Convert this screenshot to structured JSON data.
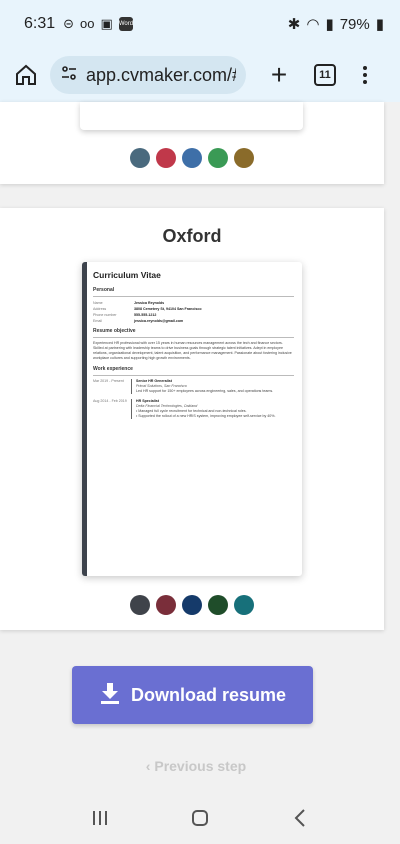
{
  "status_bar": {
    "time": "6:31",
    "left_icons": [
      "minus-circle-icon",
      "voicemail-icon",
      "image-icon",
      "app-badge-icon"
    ],
    "app_badge_text": "Word",
    "right_icons": [
      "bluetooth-icon",
      "wifi-icon",
      "signal-icon"
    ],
    "battery": "79%"
  },
  "browser": {
    "url": "app.cvmaker.com/#",
    "tab_count": "11"
  },
  "top_card": {
    "colors": [
      "#4a6a7e",
      "#c0384a",
      "#3e6fa8",
      "#3a9a55",
      "#8a6b2a"
    ]
  },
  "oxford": {
    "title": "Oxford",
    "colors": [
      "#3f434a",
      "#7a2e3a",
      "#153a6a",
      "#1f4d2a",
      "#17707a"
    ],
    "cv": {
      "heading": "Curriculum Vitae",
      "personal_label": "Personal",
      "fields": [
        {
          "key": "Name",
          "value": "Jessica Reynolds"
        },
        {
          "key": "Address",
          "value": "3808 Cemetery St, 94104 San Francisco"
        },
        {
          "key": "Phone number",
          "value": "555-555-1212"
        },
        {
          "key": "Email",
          "value": "jessica.reynolds@gmail.com"
        }
      ],
      "objective_label": "Resume objective",
      "objective": "Experienced HR professional with over 15 years in human resources management across the tech and finance sectors. Skilled at partnering with leadership teams to drive business goals through strategic talent initiatives. Adept in employee relations, organizational development, talent acquisition, and performance management. Passionate about fostering inclusive workplace cultures and supporting high growth environments.",
      "work_label": "Work experience",
      "jobs": [
        {
          "date": "Mar 2019 - Present",
          "title": "Senior HR Generalist",
          "company": "Primal Solutions, San Francisco",
          "desc": "Led HR support for 150+ employees across engineering, sales, and operations teams."
        },
        {
          "date": "Aug 2014 - Feb 2019",
          "title": "HR Specialist",
          "company": "Delta Financial Technologies, Oakland",
          "bullets": [
            "Managed full cycle recruitment for technical and non-technical roles.",
            "Supported the rollout of a new HRIS system, improving employee self-service by 40%."
          ]
        }
      ]
    }
  },
  "download_label": "Download resume",
  "prev_label": "Previous step"
}
